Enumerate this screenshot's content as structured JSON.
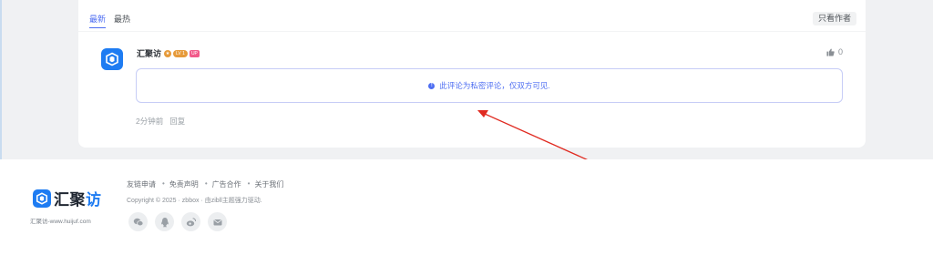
{
  "comments": {
    "tabs": [
      {
        "label": "最新",
        "active": true
      },
      {
        "label": "最热",
        "active": false
      }
    ],
    "author_only_button": "只看作者",
    "comment": {
      "author": "汇聚访",
      "badges": {
        "level": "LV 1",
        "vip": "UP"
      },
      "like_count": "0",
      "private_notice": "此评论为私密评论，仅双方可见.",
      "time": "2分钟前",
      "reply_label": "回复"
    }
  },
  "footer": {
    "logo": {
      "main": "汇聚",
      "accent": "访"
    },
    "site_url": "汇聚访-www.huijuf.com",
    "links": [
      "友链申请",
      "免责声明",
      "广告合作",
      "关于我们"
    ],
    "copyright": "Copyright © 2025 · zbbox · 由zibll主题强力驱动.",
    "socials": [
      "wechat-icon",
      "qq-icon",
      "weibo-icon",
      "email-icon"
    ]
  },
  "colors": {
    "accent": "#4e6ef2",
    "brand": "#1e7cf2",
    "annotation_arrow": "#e02a20",
    "background": "#f0f1f3"
  }
}
